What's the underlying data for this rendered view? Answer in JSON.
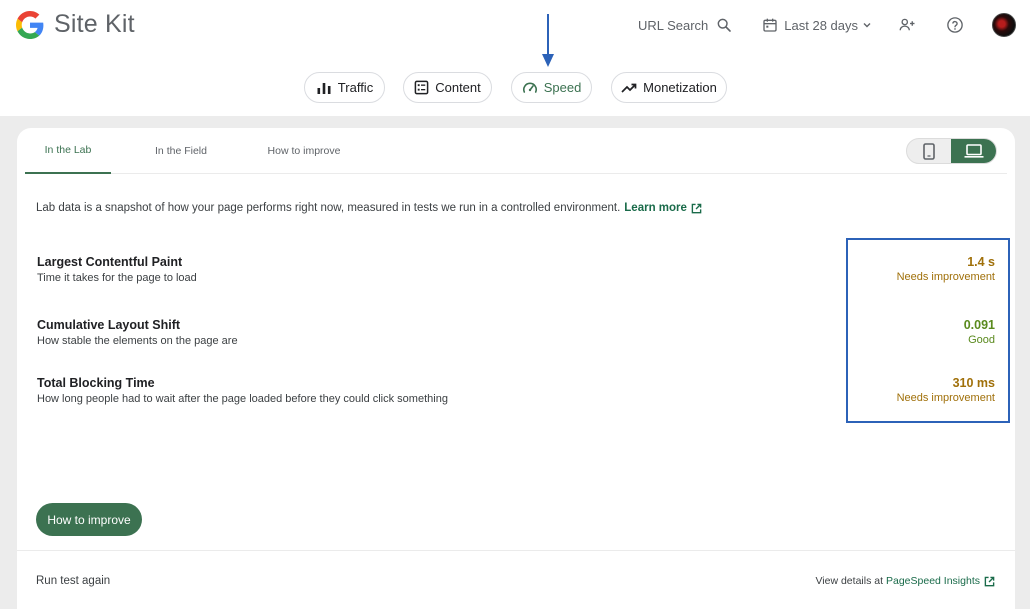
{
  "app": {
    "name": "Site Kit"
  },
  "header": {
    "url_search_label": "URL Search",
    "date_range_label": "Last 28 days",
    "icons": [
      "search-icon",
      "calendar-icon",
      "chevron-down-icon",
      "add-user-icon",
      "help-icon",
      "avatar"
    ]
  },
  "nav_chips": [
    {
      "label": "Traffic",
      "icon": "bar-chart-icon",
      "active": false
    },
    {
      "label": "Content",
      "icon": "content-list-icon",
      "active": false
    },
    {
      "label": "Speed",
      "icon": "speedometer-icon",
      "active": true
    },
    {
      "label": "Monetization",
      "icon": "trending-up-icon",
      "active": false
    }
  ],
  "tabs": [
    {
      "label": "In the Lab",
      "active": true
    },
    {
      "label": "In the Field",
      "active": false
    },
    {
      "label": "How to improve",
      "active": false
    }
  ],
  "device_toggle": {
    "options": [
      "mobile",
      "desktop"
    ],
    "selected": "desktop"
  },
  "intro": {
    "text": "Lab data is a snapshot of how your page performs right now, measured in tests we run in a controlled environment.",
    "link_label": "Learn more"
  },
  "metrics": [
    {
      "title": "Largest Contentful Paint",
      "description": "Time it takes for the page to load",
      "value": "1.4 s",
      "status": "Needs improvement"
    },
    {
      "title": "Cumulative Layout Shift",
      "description": "How stable the elements on the page are",
      "value": "0.091",
      "status": "Good"
    },
    {
      "title": "Total Blocking Time",
      "description": "How long people had to wait after the page loaded before they could click something",
      "value": "310 ms",
      "status": "Needs improvement"
    }
  ],
  "status_colors": {
    "Needs improvement": "#a0700a",
    "Good": "#5a8a1e"
  },
  "improve_button_label": "How to improve",
  "footer": {
    "run_test_label": "Run test again",
    "view_details_prefix": "View details at",
    "psi_link_label": "PageSpeed Insights"
  },
  "colors": {
    "accent": "#3c7251",
    "link": "#1a6b4a",
    "annotation": "#2c62b8"
  }
}
